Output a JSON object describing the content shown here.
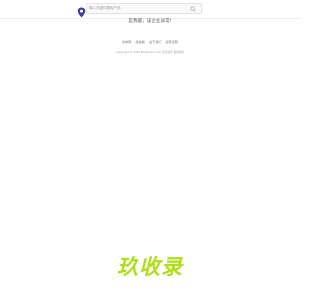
{
  "header": {
    "search": {
      "placeholder": "输入关键词搜索产品"
    },
    "search_icon": "search-icon",
    "logo_icon": "location-pin-icon"
  },
  "main": {
    "message": "是我最，该企业异常!"
  },
  "footer": {
    "links": [
      "供求网",
      "权益联",
      "关于我们",
      "运营证明"
    ],
    "copyright": "Copyright © 2023 Maxqiuxio.com 北京技术 备案所有"
  },
  "watermark": {
    "text": "玖收录"
  },
  "colors": {
    "watermark": "#aedf1a",
    "logo_blue": "#3b3ba8",
    "text": "#5a5a5a"
  }
}
